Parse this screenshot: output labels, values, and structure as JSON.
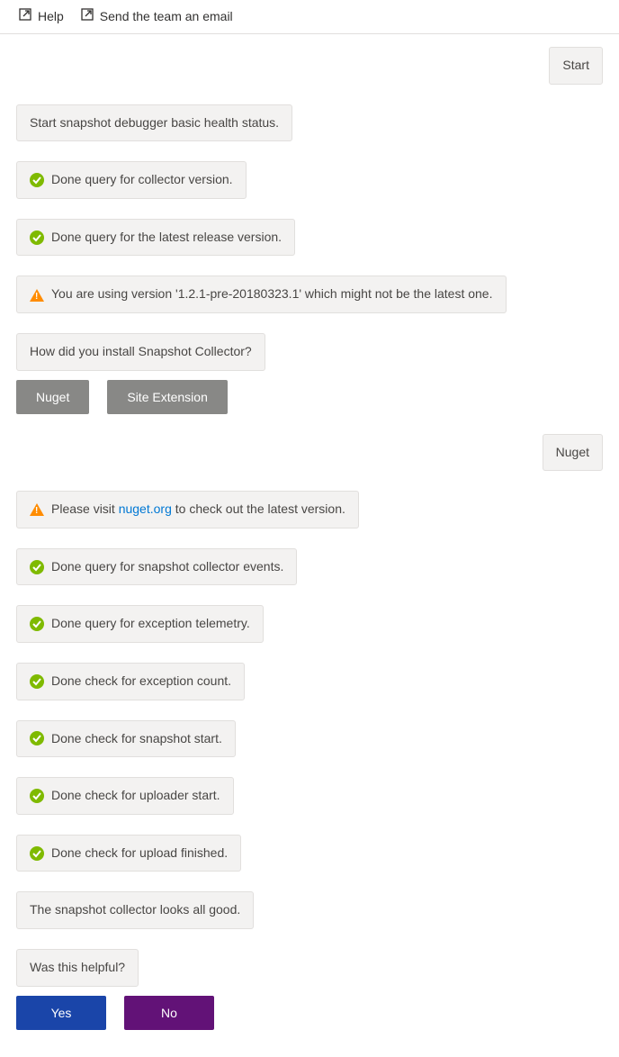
{
  "toolbar": {
    "help": "Help",
    "email": "Send the team an email"
  },
  "chat": {
    "user_start": "Start",
    "m1": "Start snapshot debugger basic health status.",
    "m2": "Done query for collector version.",
    "m3": "Done query for the latest release version.",
    "m4": "You are using version '1.2.1-pre-20180323.1' which might not be the latest one.",
    "m5": "How did you install Snapshot Collector?",
    "btn_nuget": "Nuget",
    "btn_site_ext": "Site Extension",
    "user_nuget": "Nuget",
    "m6_pre": "Please visit ",
    "m6_link": "nuget.org",
    "m6_post": " to check out the latest version.",
    "m7": "Done query for snapshot collector events.",
    "m8": "Done query for exception telemetry.",
    "m9": "Done check for exception count.",
    "m10": "Done check for snapshot start.",
    "m11": "Done check for uploader start.",
    "m12": "Done check for upload finished.",
    "m13": "The snapshot collector looks all good.",
    "m14": "Was this helpful?",
    "btn_yes": "Yes",
    "btn_no": "No"
  }
}
